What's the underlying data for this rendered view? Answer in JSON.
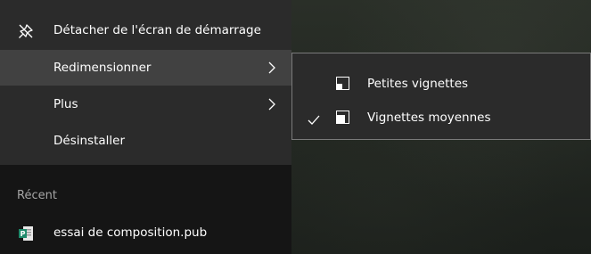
{
  "context_menu": {
    "items": [
      {
        "label": "Détacher de l'écran de démarrage",
        "icon": "unpin-icon"
      },
      {
        "label": "Redimensionner",
        "icon": "chevron-right-icon",
        "highlighted": true
      },
      {
        "label": "Plus",
        "icon": "chevron-right-icon"
      },
      {
        "label": "Désinstaller"
      }
    ]
  },
  "submenu": {
    "items": [
      {
        "label": "Petites vignettes",
        "icon": "small-tile-icon",
        "checked": false
      },
      {
        "label": "Vignettes moyennes",
        "icon": "medium-tile-icon",
        "checked": true
      }
    ]
  },
  "recent": {
    "header": "Récent",
    "files": [
      {
        "name": "essai de composition.pub",
        "icon": "publisher-file-icon"
      }
    ]
  },
  "colors": {
    "menu_bg": "#2b2b2b",
    "menu_highlight": "#414141",
    "lower_panel_bg": "#151515",
    "submenu_border": "#7a7a7a",
    "publisher_accent": "#1f8a6b"
  }
}
